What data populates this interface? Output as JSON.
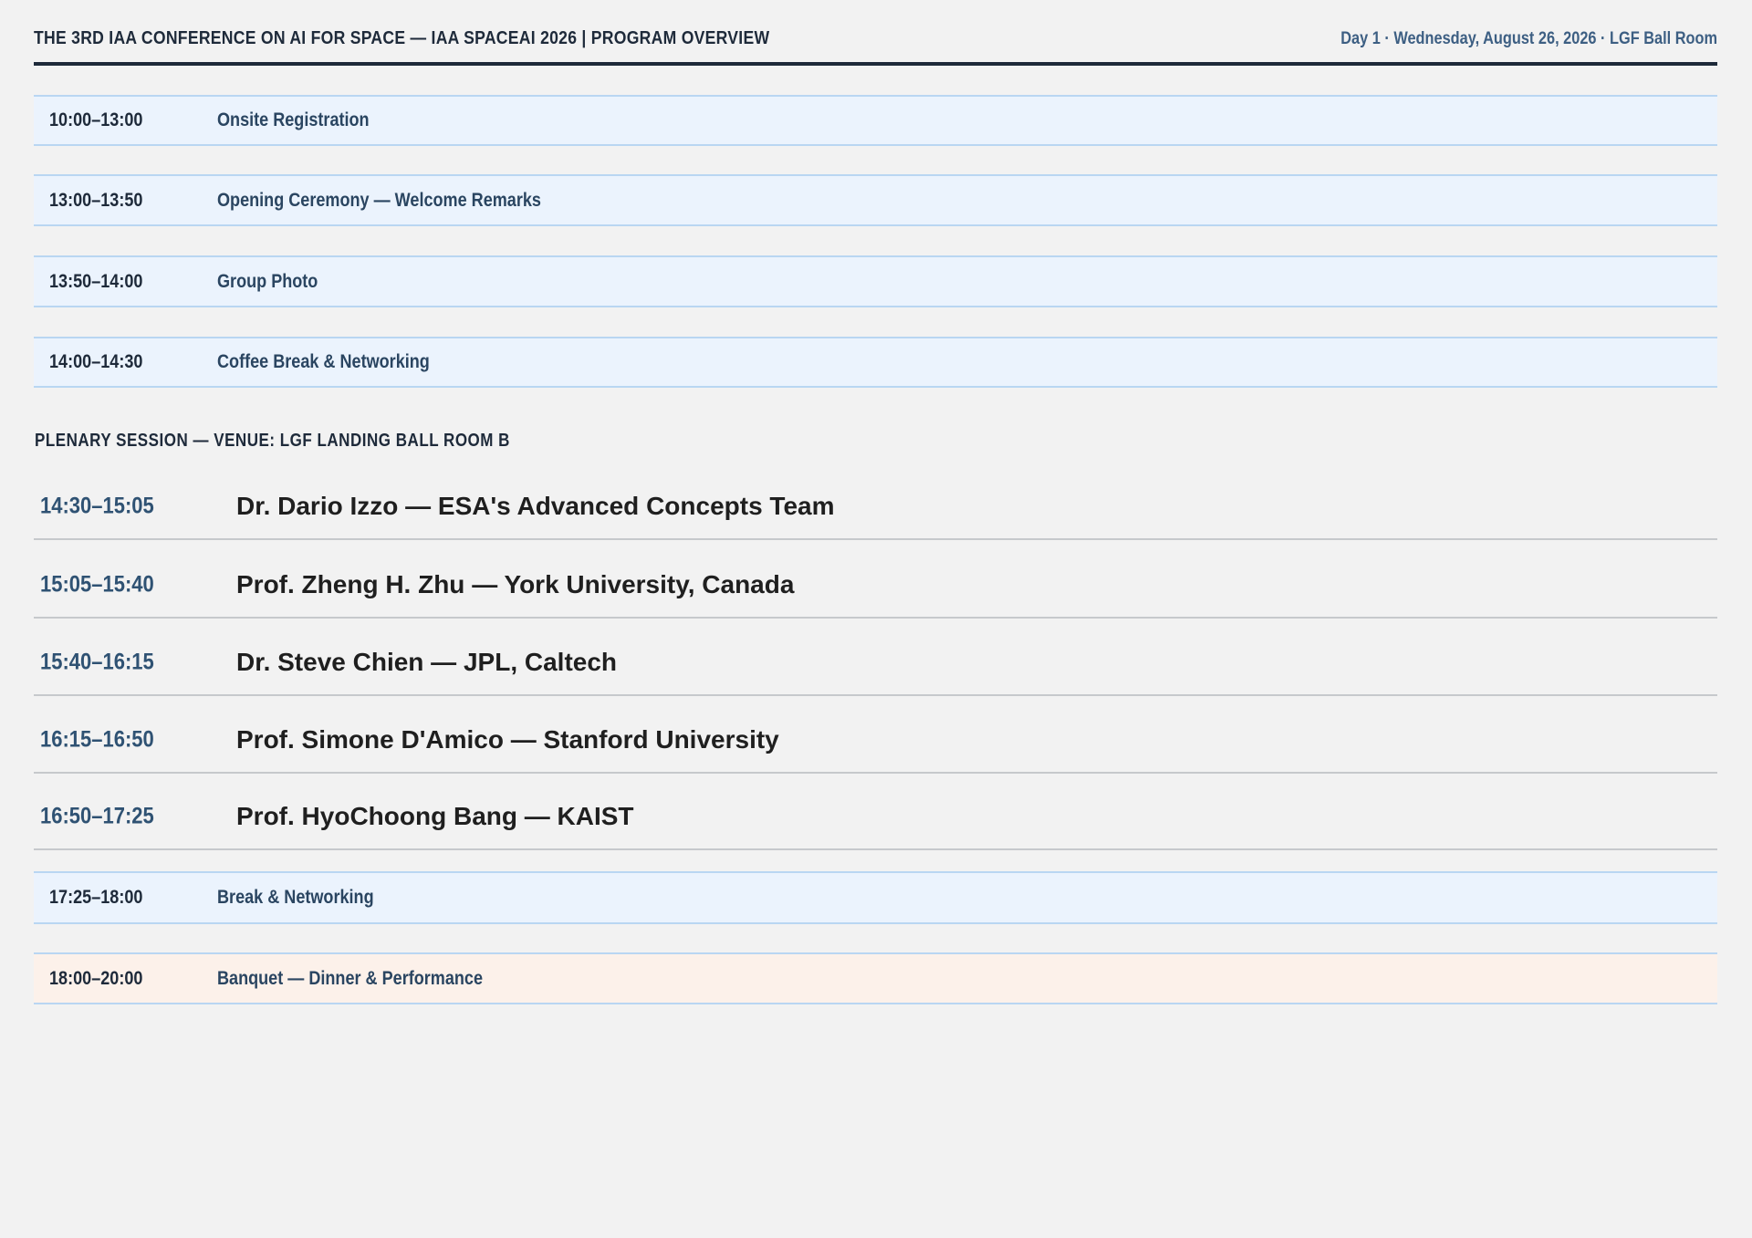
{
  "header": {
    "title": "THE 3RD IAA CONFERENCE ON AI FOR SPACE — IAA SPACEAI 2026  |  PROGRAM OVERVIEW",
    "day_info": "Day 1 · Wednesday, August 26, 2026 · LGF Ball Room"
  },
  "pre_sessions": [
    {
      "time": "10:00–13:00",
      "label": "Onsite Registration"
    },
    {
      "time": "13:00–13:50",
      "label": "Opening Ceremony — Welcome Remarks"
    },
    {
      "time": "13:50–14:00",
      "label": "Group Photo"
    },
    {
      "time": "14:00–14:30",
      "label": "Coffee Break & Networking"
    }
  ],
  "plenary": {
    "heading": "PLENARY SESSION — VENUE: LGF LANDING BALL ROOM B",
    "talks": [
      {
        "time": "14:30–15:05",
        "speaker": "Dr. Dario Izzo — ESA's Advanced Concepts Team"
      },
      {
        "time": "15:05–15:40",
        "speaker": "Prof. Zheng H. Zhu — York University, Canada"
      },
      {
        "time": "15:40–16:15",
        "speaker": "Dr. Steve Chien — JPL, Caltech"
      },
      {
        "time": "16:15–16:50",
        "speaker": "Prof. Simone D'Amico — Stanford University"
      },
      {
        "time": "16:50–17:25",
        "speaker": "Prof. HyoChoong Bang — KAIST"
      }
    ]
  },
  "post_sessions": [
    {
      "time": "17:25–18:00",
      "label": "Break & Networking"
    },
    {
      "time": "18:00–20:00",
      "label": "Banquet — Dinner & Performance"
    }
  ],
  "colors": {
    "page_bg": "#f2f2f2",
    "row_bg": "#ebf3fd",
    "row_border": "#b9d6f2",
    "banquet_bg": "#fcf1ea",
    "accent_blue": "#2f5273",
    "header_rule": "#1e2a3a"
  }
}
